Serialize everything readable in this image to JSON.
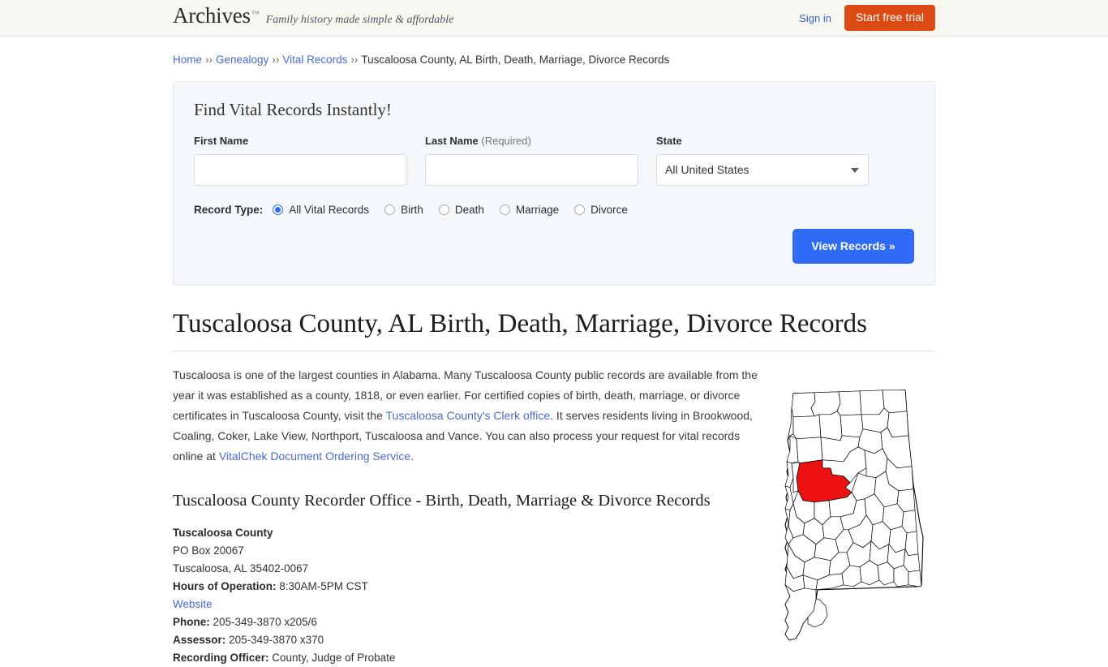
{
  "header": {
    "brand_name": "Archives",
    "brand_tm": "™",
    "tagline": "Family history made simple & affordable",
    "signin_label": "Sign in",
    "trial_label": "Start free trial",
    "trial_color": "#dd4b14",
    "background": "#f7f7f2"
  },
  "breadcrumb": {
    "items": [
      {
        "label": "Home",
        "link": true
      },
      {
        "label": "Genealogy",
        "link": true
      },
      {
        "label": "Vital Records",
        "link": true
      },
      {
        "label": "Tuscaloosa County, AL Birth, Death, Marriage, Divorce Records",
        "link": false
      }
    ],
    "separator": "››"
  },
  "search_panel": {
    "title": "Find Vital Records Instantly!",
    "first_name": {
      "label": "First Name",
      "value": "",
      "placeholder": ""
    },
    "last_name": {
      "label": "Last Name",
      "required_note": "(Required)",
      "value": "",
      "placeholder": ""
    },
    "state": {
      "label": "State",
      "selected": "All United States",
      "options": [
        "All United States"
      ]
    },
    "record_type": {
      "label": "Record Type:",
      "selected": "All Vital Records",
      "options": [
        {
          "label": "All Vital Records",
          "checked": true
        },
        {
          "label": "Birth",
          "checked": false
        },
        {
          "label": "Death",
          "checked": false
        },
        {
          "label": "Marriage",
          "checked": false
        },
        {
          "label": "Divorce",
          "checked": false
        }
      ]
    },
    "submit_label": "View Records »",
    "submit_color": "#2f6bf5",
    "panel_background": "#f5f8fb"
  },
  "main": {
    "title": "Tuscaloosa County, AL Birth, Death, Marriage, Divorce Records",
    "intro": {
      "part1": "Tuscaloosa is one of the largest counties in Alabama. Many Tuscaloosa County public records are available from the year it was established as a county, 1818, or even earlier. For certified copies of birth, death, marriage, or divorce certificates in Tuscaloosa County, visit the ",
      "link1": "Tuscaloosa County's Clerk office",
      "part2": ". It serves residents living in Brookwood, Coaling, Coker, Lake View, Northport, Tuscaloosa and Vance. You can also process your request for vital records online at ",
      "link2": "VitalChek Document Ordering Service",
      "part3": "."
    },
    "subtitle": "Tuscaloosa County Recorder Office - Birth, Death, Marriage & Divorce Records",
    "office": {
      "name": "Tuscaloosa County",
      "address_line1": "PO Box 20067",
      "address_line2": "Tuscaloosa, AL 35402-0067",
      "hours_label": "Hours of Operation:",
      "hours_value": "8:30AM-5PM CST",
      "website_label": "Website",
      "phone_label": "Phone:",
      "phone_value": "205-349-3870 x205/6",
      "assessor_label": "Assessor:",
      "assessor_value": "205-349-3870 x370",
      "recording_officer_label": "Recording Officer:",
      "recording_officer_value": "County, Judge of Probate"
    },
    "map": {
      "state": "Alabama",
      "highlighted_county": "Tuscaloosa",
      "highlight_color": "#ee1111",
      "outline_color": "#000000"
    }
  }
}
